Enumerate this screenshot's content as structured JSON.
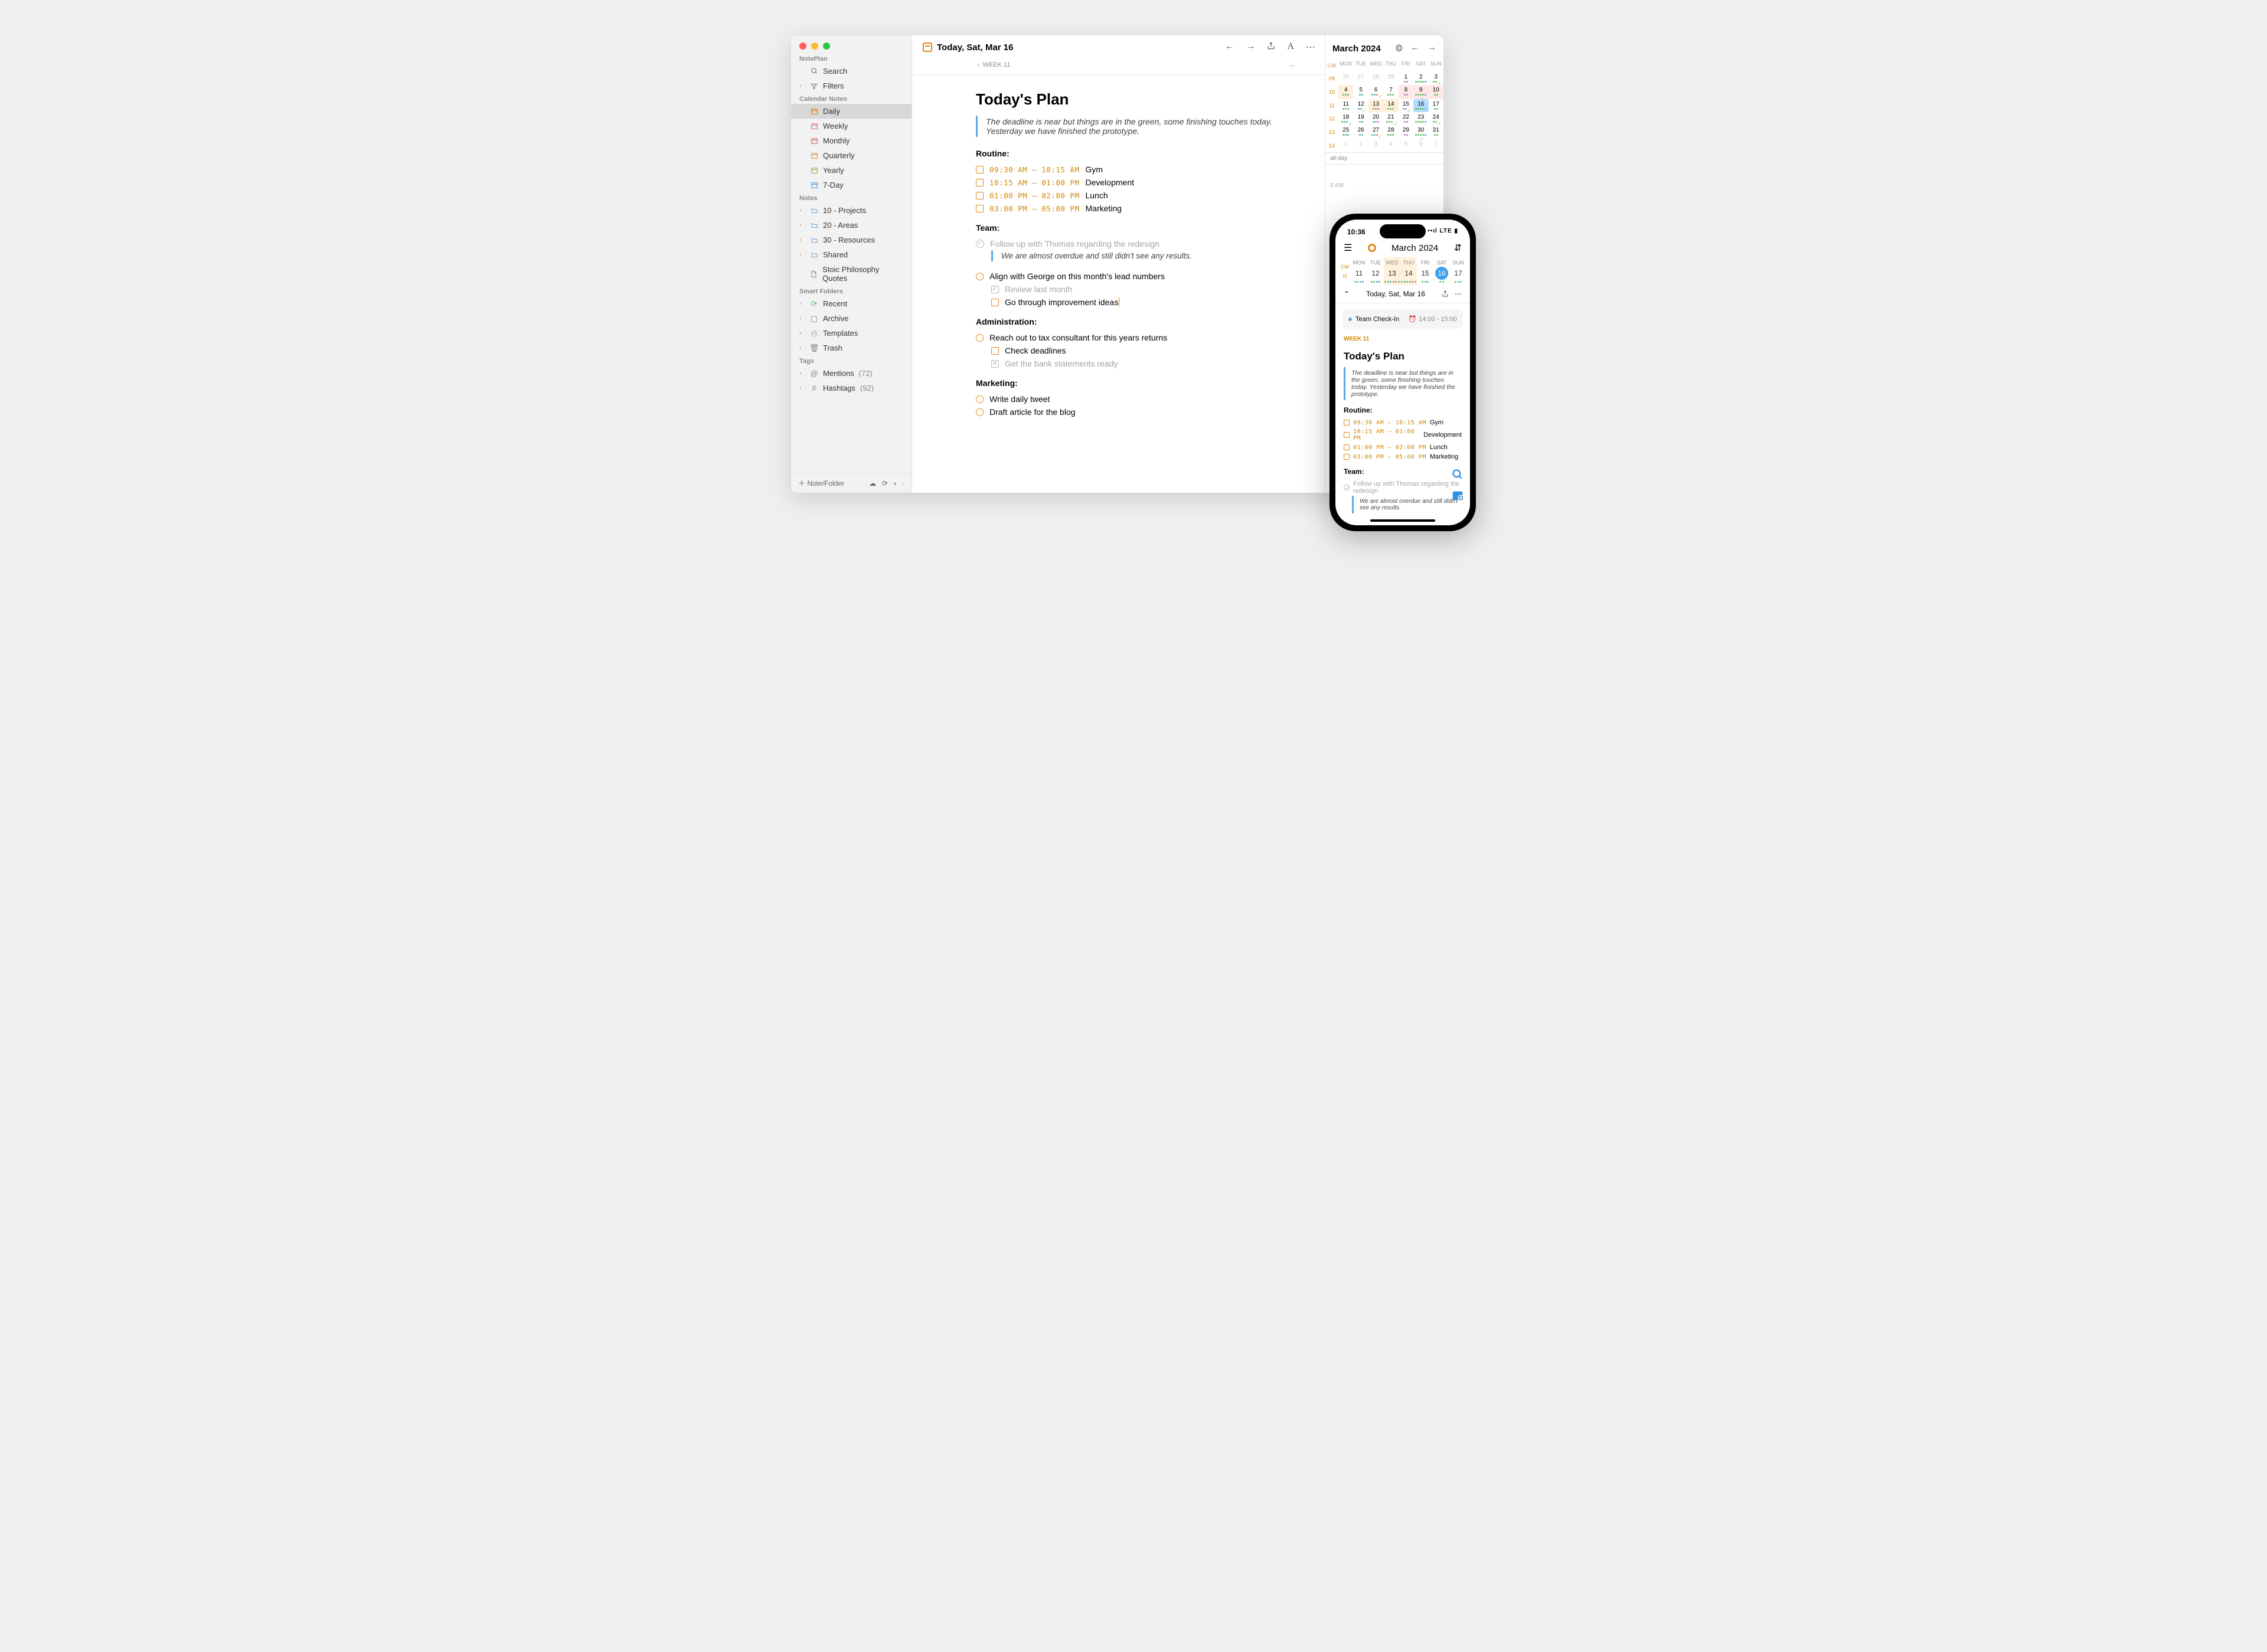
{
  "sidebar": {
    "app": "NotePlan",
    "search": "Search",
    "filters": "Filters",
    "sections": {
      "calNotes": "Calendar Notes",
      "notes": "Notes",
      "smart": "Smart Folders",
      "tags": "Tags"
    },
    "cal": [
      "Daily",
      "Weekly",
      "Monthly",
      "Quarterly",
      "Yearly",
      "7-Day"
    ],
    "notes": [
      "10 - Projects",
      "20 - Areas",
      "30 - Resources",
      "Shared"
    ],
    "notesFile": "Stoic Philosophy Quotes",
    "smart": [
      "Recent",
      "Archive",
      "Templates",
      "Trash"
    ],
    "tags": {
      "mentions": {
        "label": "Mentions",
        "count": "(72)"
      },
      "hashtags": {
        "label": "Hashtags",
        "count": "(92)"
      }
    },
    "footer": "Note/Folder"
  },
  "topbar": {
    "title": "Today, Sat, Mar 16",
    "week": "WEEK 11"
  },
  "plan": {
    "title": "Today's Plan",
    "quote": "The deadline is near but things are in the green, some finishing touches today. Yesterday we have finished the prototype.",
    "routineHead": "Routine:",
    "routine": [
      {
        "time": "09:30 AM – 10:15 AM",
        "label": "Gym"
      },
      {
        "time": "10:15 AM – 01:00 PM",
        "label": "Development"
      },
      {
        "time": "01:00 PM – 02:00 PM",
        "label": "Lunch"
      },
      {
        "time": "03:00 PM – 05:00 PM",
        "label": "Marketing"
      }
    ],
    "teamHead": "Team:",
    "team1": "Follow up with Thomas regarding the redesign",
    "teamQuote": "We are almost overdue and still didn't see any results.",
    "team2": "Align with George on this month's lead numbers",
    "team2a": "Review last month",
    "team2b": "Go through improvement ideas",
    "adminHead": "Administration:",
    "admin1": "Reach out to tax consultant for this years returns",
    "admin1a": "Check deadlines",
    "admin1b": "Get the bank statements ready",
    "mktHead": "Marketing:",
    "mkt1": "Write daily tweet",
    "mkt2": "Draft article for the blog"
  },
  "calendar": {
    "month": "March 2024",
    "head": [
      "CW",
      "MON",
      "TUE",
      "WED",
      "THU",
      "FRI",
      "SAT",
      "SUN"
    ],
    "weeks": [
      {
        "cw": "09",
        "days": [
          {
            "n": "26",
            "o": 1
          },
          {
            "n": "27",
            "o": 1
          },
          {
            "n": "28",
            "o": 1
          },
          {
            "n": "29",
            "o": 1
          },
          {
            "n": "1"
          },
          {
            "n": "2"
          },
          {
            "n": "3"
          }
        ]
      },
      {
        "cw": "10",
        "days": [
          {
            "n": "4",
            "hl": 1
          },
          {
            "n": "5"
          },
          {
            "n": "6"
          },
          {
            "n": "7"
          },
          {
            "n": "8",
            "red": 1
          },
          {
            "n": "9",
            "red": 1
          },
          {
            "n": "10",
            "red": 1
          }
        ]
      },
      {
        "cw": "11",
        "days": [
          {
            "n": "11"
          },
          {
            "n": "12"
          },
          {
            "n": "13",
            "hl": 1
          },
          {
            "n": "14",
            "hl": 1
          },
          {
            "n": "15"
          },
          {
            "n": "16",
            "today": 1
          },
          {
            "n": "17"
          }
        ]
      },
      {
        "cw": "12",
        "days": [
          {
            "n": "18"
          },
          {
            "n": "19"
          },
          {
            "n": "20"
          },
          {
            "n": "21"
          },
          {
            "n": "22"
          },
          {
            "n": "23"
          },
          {
            "n": "24"
          }
        ]
      },
      {
        "cw": "13",
        "days": [
          {
            "n": "25"
          },
          {
            "n": "26"
          },
          {
            "n": "27"
          },
          {
            "n": "28"
          },
          {
            "n": "29"
          },
          {
            "n": "30"
          },
          {
            "n": "31"
          }
        ]
      },
      {
        "cw": "14",
        "days": [
          {
            "n": "1",
            "o": 1
          },
          {
            "n": "2",
            "o": 1
          },
          {
            "n": "3",
            "o": 1
          },
          {
            "n": "4",
            "o": 1
          },
          {
            "n": "5",
            "o": 1
          },
          {
            "n": "6",
            "o": 1
          },
          {
            "n": "7",
            "o": 1
          }
        ]
      }
    ],
    "allday": "all-day",
    "slot": "9 AM"
  },
  "phone": {
    "time": "10:36",
    "carrier": "LTE",
    "month": "March 2024",
    "head": [
      "MON",
      "TUE",
      "WED",
      "THU",
      "FRI",
      "SAT",
      "SUN"
    ],
    "cw": "CW",
    "cwnum": "11",
    "days": [
      {
        "n": "11"
      },
      {
        "n": "12"
      },
      {
        "n": "13",
        "hl": 1
      },
      {
        "n": "14",
        "hl": 1
      },
      {
        "n": "15"
      },
      {
        "n": "16",
        "today": 1
      },
      {
        "n": "17"
      }
    ],
    "todayTitle": "Today, Sat, Mar 16",
    "event": {
      "title": "Team Check-In",
      "time": "14:00 - 15:00"
    },
    "weekLabel": "WEEK 11"
  }
}
